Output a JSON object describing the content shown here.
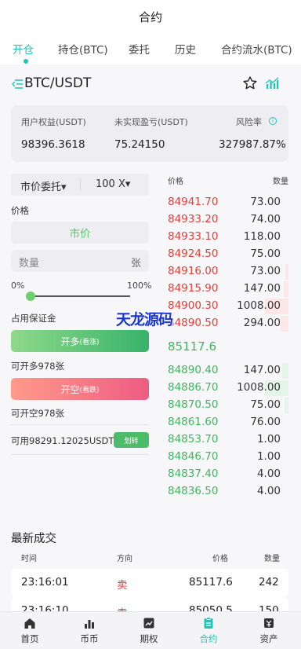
{
  "header": {
    "title": "合约"
  },
  "tabs": [
    "开仓",
    "持仓(BTC)",
    "委托",
    "历史",
    "合约流水(BTC)"
  ],
  "pair": {
    "symbol": "BTC/USDT"
  },
  "stats": [
    {
      "label": "用户权益(USDT)",
      "value": "98396.3618"
    },
    {
      "label": "未实现盈亏(USDT)",
      "value": "75.24150"
    },
    {
      "label": "风险率",
      "value": "327987.87%"
    }
  ],
  "order_form": {
    "order_type": "市价委托",
    "leverage": "100 X",
    "price_label": "价格",
    "price_value": "市价",
    "qty_placeholder": "数量",
    "qty_unit": "张",
    "pct_min": "0%",
    "pct_max": "100%",
    "slider_value": 0,
    "margin_label": "占用保证金",
    "long_button": "开多",
    "long_sub": "(看涨)",
    "long_available": "可开多978张",
    "short_button": "开空",
    "short_sub": "(看跌)",
    "short_available": "可开空978张",
    "available_balance": "可用98291.12025USDT",
    "transfer_button": "划转"
  },
  "orderbook": {
    "price_header": "价格",
    "qty_header": "数量",
    "asks": [
      {
        "price": "84941.70",
        "qty": "73.00"
      },
      {
        "price": "84933.20",
        "qty": "74.00"
      },
      {
        "price": "84933.10",
        "qty": "118.00"
      },
      {
        "price": "84924.50",
        "qty": "75.00"
      },
      {
        "price": "84916.00",
        "qty": "73.00"
      },
      {
        "price": "84915.90",
        "qty": "147.00"
      },
      {
        "price": "84900.30",
        "qty": "1008.00"
      },
      {
        "price": "84890.50",
        "qty": "294.00"
      }
    ],
    "mid_price": "85117.6",
    "bids": [
      {
        "price": "84890.40",
        "qty": "147.00"
      },
      {
        "price": "84886.70",
        "qty": "1008.00"
      },
      {
        "price": "84870.50",
        "qty": "75.00"
      },
      {
        "price": "84861.60",
        "qty": "76.00"
      },
      {
        "price": "84853.70",
        "qty": "1.00"
      },
      {
        "price": "84846.70",
        "qty": "1.00"
      },
      {
        "price": "84837.40",
        "qty": "4.00"
      },
      {
        "price": "84836.50",
        "qty": "4.00"
      }
    ]
  },
  "watermark": "天龙源码",
  "trades": {
    "title": "最新成交",
    "headers": [
      "时间",
      "方向",
      "价格",
      "数量"
    ],
    "rows": [
      {
        "time": "23:16:01",
        "side": "卖",
        "price": "85117.6",
        "qty": "242"
      },
      {
        "time": "23:16:10",
        "side": "卖",
        "price": "85050.5",
        "qty": "150"
      }
    ]
  },
  "nav": [
    "首页",
    "币币",
    "期权",
    "合约",
    "资产"
  ],
  "colors": {
    "accent": "#1fc6b4",
    "ask": "#e0403a",
    "bid": "#3fb560"
  }
}
